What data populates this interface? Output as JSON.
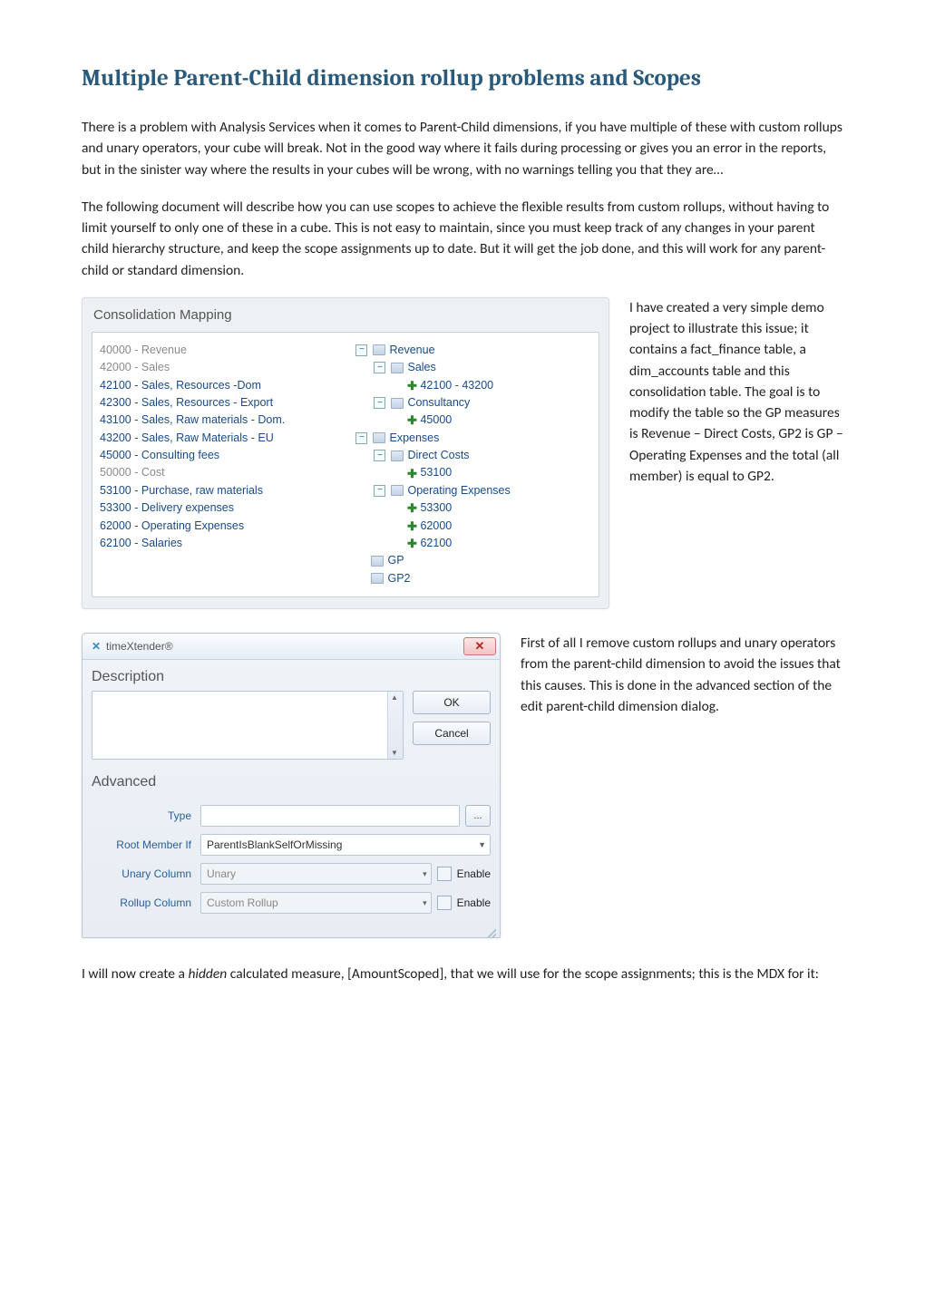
{
  "title": "Multiple Parent-Child dimension rollup problems and Scopes",
  "paragraphs": {
    "p1": "There is a problem with Analysis Services when it comes to Parent-Child dimensions, if you have multiple of these with custom rollups and unary operators, your cube will break. Not in the good way where it fails during processing or gives you an error in the reports, but in the sinister way where the results in your cubes will be wrong, with no warnings telling you that they are…",
    "p2": "The following document will describe how you can use scopes to achieve the flexible results from custom rollups, without having to limit yourself to only one of these in a cube. This is not easy to maintain, since you must keep track of any changes in your parent child hierarchy structure, and keep the scope assignments up to date. But it will get the job done, and this will work for any parent-child or standard dimension.",
    "side1": "I have created a very simple demo project to illustrate this issue; it contains a fact_finance table, a dim_accounts table and this consolidation table. The goal is to modify the table so the GP measures is Revenue – Direct Costs, GP2 is GP – Operating Expenses and the total (all member) is equal to GP2.",
    "side2": "First of all I remove custom rollups and unary operators from the parent-child dimension to avoid the issues that this causes. This is done in the advanced section of the edit parent-child dimension dialog.",
    "p3a": "I will now create a ",
    "p3b": "hidden",
    "p3c": " calculated measure, [AmountScoped], that we will use for the scope assignments; this is the MDX for it:"
  },
  "consolidation": {
    "title": "Consolidation Mapping",
    "leftList": [
      {
        "text": "40000 - Revenue",
        "dim": true
      },
      {
        "text": "42000 - Sales",
        "dim": true
      },
      {
        "text": "42100 - Sales, Resources -Dom",
        "dim": false
      },
      {
        "text": "42300 - Sales, Resources - Export",
        "dim": false
      },
      {
        "text": "43100 - Sales, Raw materials - Dom.",
        "dim": false
      },
      {
        "text": "43200 - Sales, Raw Materials - EU",
        "dim": false
      },
      {
        "text": "45000 - Consulting fees",
        "dim": false
      },
      {
        "text": "50000 - Cost",
        "dim": true
      },
      {
        "text": "53100 - Purchase, raw materials",
        "dim": false
      },
      {
        "text": "53300 - Delivery expenses",
        "dim": false
      },
      {
        "text": "62000 - Operating Expenses",
        "dim": false
      },
      {
        "text": "62100 - Salaries",
        "dim": false
      }
    ],
    "tree": [
      {
        "indent": 0,
        "exp": "−",
        "icon": "folder",
        "label": "Revenue"
      },
      {
        "indent": 1,
        "exp": "−",
        "icon": "folder",
        "label": "Sales"
      },
      {
        "indent": 2,
        "exp": "",
        "icon": "plus",
        "label": "42100 - 43200"
      },
      {
        "indent": 1,
        "exp": "−",
        "icon": "folder",
        "label": "Consultancy"
      },
      {
        "indent": 2,
        "exp": "",
        "icon": "plus",
        "label": "45000"
      },
      {
        "indent": 0,
        "exp": "−",
        "icon": "folder",
        "label": "Expenses"
      },
      {
        "indent": 1,
        "exp": "−",
        "icon": "folder",
        "label": "Direct Costs"
      },
      {
        "indent": 2,
        "exp": "",
        "icon": "plus",
        "label": "53100"
      },
      {
        "indent": 1,
        "exp": "−",
        "icon": "folder",
        "label": "Operating Expenses"
      },
      {
        "indent": 2,
        "exp": "",
        "icon": "plus",
        "label": "53300"
      },
      {
        "indent": 2,
        "exp": "",
        "icon": "plus",
        "label": "62000"
      },
      {
        "indent": 2,
        "exp": "",
        "icon": "plus",
        "label": "62100"
      },
      {
        "indent": 0,
        "exp": "",
        "icon": "folder",
        "label": "GP"
      },
      {
        "indent": 0,
        "exp": "",
        "icon": "folder",
        "label": "GP2"
      }
    ]
  },
  "dialog": {
    "appTitle": "timeXtender®",
    "sections": {
      "description": "Description",
      "advanced": "Advanced"
    },
    "buttons": {
      "ok": "OK",
      "cancel": "Cancel",
      "browse": "..."
    },
    "rows": {
      "type": "Type",
      "rootMemberIf": "Root Member If",
      "unaryColumn": "Unary Column",
      "rollupColumn": "Rollup Column"
    },
    "values": {
      "type": "",
      "rootMemberIf": "ParentIsBlankSelfOrMissing",
      "unaryColumn": "Unary",
      "rollupColumn": "Custom Rollup"
    },
    "enableLabel": "Enable"
  }
}
